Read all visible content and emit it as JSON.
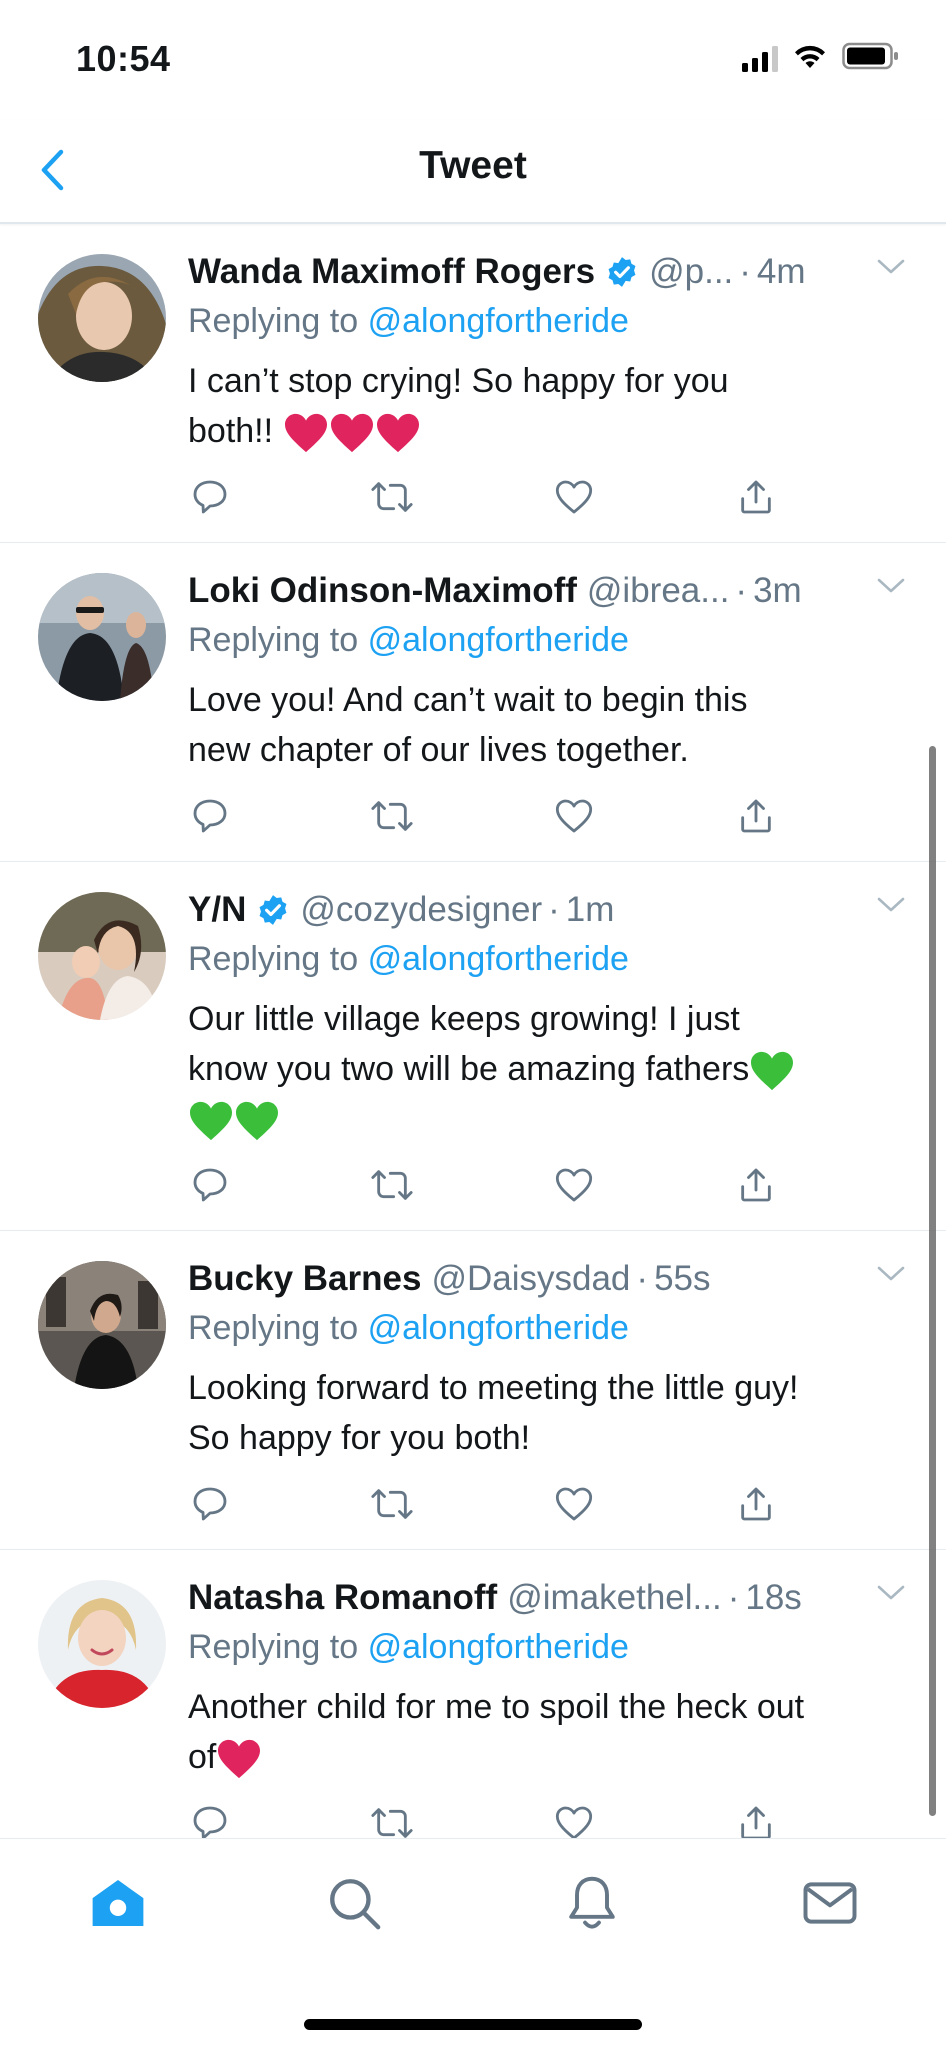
{
  "status_bar": {
    "time": "10:54"
  },
  "header": {
    "title": "Tweet"
  },
  "colors": {
    "accent": "#1da1f2",
    "muted": "#657786",
    "heart_red": "#e0245e",
    "heart_green": "#3bbf3b"
  },
  "replies": [
    {
      "display_name": "Wanda Maximoff Rogers",
      "verified": true,
      "handle": "@p...",
      "time": "4m",
      "replying_prefix": "Replying to",
      "replying_to": "@alongfortheride",
      "text_lines": [
        "I can’t stop crying! So happy for you",
        "both!!"
      ],
      "emoji": [
        "red-heart",
        "red-heart",
        "red-heart"
      ]
    },
    {
      "display_name": "Loki Odinson-Maximoff",
      "verified": false,
      "handle": "@ibrea...",
      "time": "3m",
      "replying_prefix": "Replying to",
      "replying_to": "@alongfortheride",
      "text_lines": [
        "Love you! And can’t wait to begin this",
        "new chapter of our lives together."
      ],
      "emoji": []
    },
    {
      "display_name": "Y/N",
      "verified": true,
      "handle": "@cozydesigner",
      "time": "1m",
      "replying_prefix": "Replying to",
      "replying_to": "@alongfortheride",
      "text_lines": [
        "Our little village keeps growing! I just",
        "know you two will be amazing fathers"
      ],
      "emoji": [
        "green-heart",
        "green-heart",
        "green-heart"
      ]
    },
    {
      "display_name": "Bucky Barnes",
      "verified": false,
      "handle": "@Daisysdad",
      "time": "55s",
      "replying_prefix": "Replying to",
      "replying_to": "@alongfortheride",
      "text_lines": [
        "Looking forward to meeting the little guy!",
        "So happy for you both!"
      ],
      "emoji": []
    },
    {
      "display_name": "Natasha Romanoff",
      "verified": false,
      "handle": "@imakethel...",
      "time": "18s",
      "replying_prefix": "Replying to",
      "replying_to": "@alongfortheride",
      "text_lines": [
        "Another child for me to spoil the heck out",
        "of"
      ],
      "emoji": [
        "red-heart"
      ]
    }
  ],
  "tabs": [
    "home-icon",
    "search-icon",
    "notifications-icon",
    "messages-icon"
  ]
}
